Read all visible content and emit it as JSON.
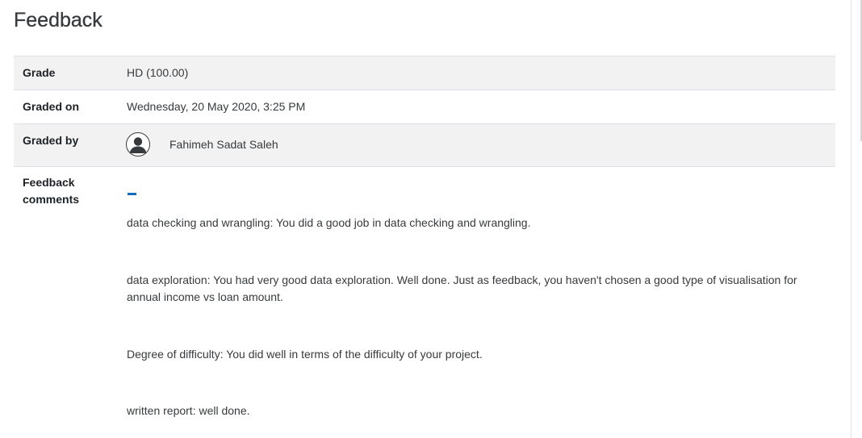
{
  "page": {
    "title": "Feedback"
  },
  "rows": {
    "grade": {
      "label": "Grade",
      "value": "HD (100.00)"
    },
    "graded_on": {
      "label": "Graded on",
      "value": "Wednesday, 20 May 2020, 3:25 PM"
    },
    "graded_by": {
      "label": "Graded by",
      "avatar_icon": "user-avatar-icon",
      "value": "Fahimeh Sadat Saleh"
    },
    "feedback_comments": {
      "label": "Feedback comments",
      "toggle_icon": "collapse-minus-icon",
      "paragraphs": [
        "data checking and wrangling: You did a good job in data checking and wrangling.",
        "data exploration: You had very good data exploration. Well done. Just as feedback, you haven't chosen a good type of visualisation for annual income vs loan amount.",
        "Degree of difficulty: You did well in terms of the difficulty of your project.",
        "written report: well done."
      ]
    }
  },
  "colors": {
    "row_shade": "#f2f2f2",
    "border": "#dee2e6",
    "text": "#373a3c",
    "accent": "#0f6cbf"
  }
}
